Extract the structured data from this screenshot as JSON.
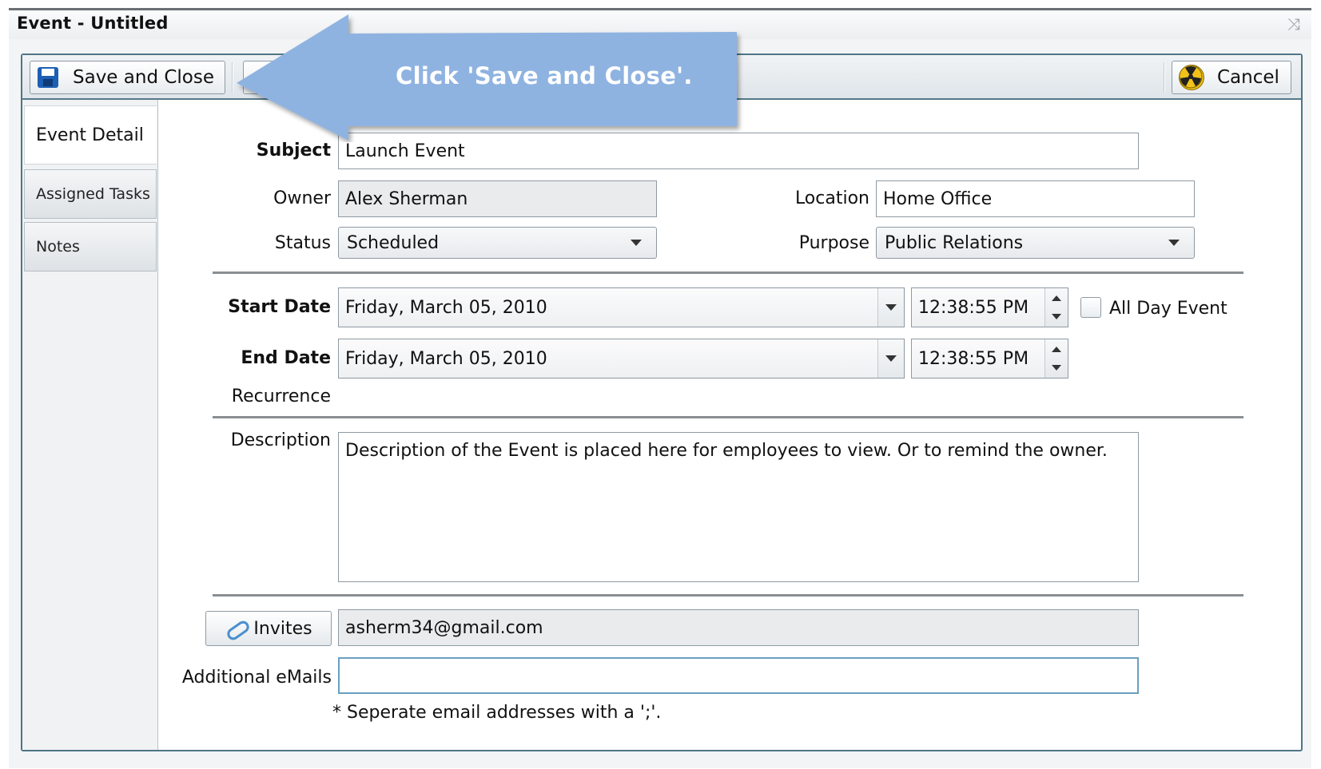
{
  "window": {
    "title": "Event - Untitled",
    "close_glyph": "⤨"
  },
  "toolbar": {
    "save_label": "Save and Close",
    "cancel_label": "Cancel"
  },
  "callout": {
    "text": "Click 'Save and Close'."
  },
  "tabs": [
    {
      "label": "Event Detail"
    },
    {
      "label": "Assigned Tasks"
    },
    {
      "label": "Notes"
    }
  ],
  "form": {
    "subject": {
      "label": "Subject",
      "value": "Launch Event"
    },
    "owner": {
      "label": "Owner",
      "value": "Alex Sherman"
    },
    "location": {
      "label": "Location",
      "value": "Home Office"
    },
    "status": {
      "label": "Status",
      "value": "Scheduled"
    },
    "purpose": {
      "label": "Purpose",
      "value": "Public Relations"
    },
    "start": {
      "label": "Start Date",
      "date": "Friday, March 05, 2010",
      "time": "12:38:55 PM"
    },
    "all_day": {
      "label": "All Day Event",
      "checked": false
    },
    "end": {
      "label": "End Date",
      "date": "Friday, March 05, 2010",
      "time": "12:38:55 PM"
    },
    "recurrence": {
      "label": "Recurrence"
    },
    "description": {
      "label": "Description",
      "value": "Description of the Event is placed here for employees to view. Or to remind the owner."
    },
    "invites": {
      "button_label": "Invites",
      "value": "asherm34@gmail.com"
    },
    "additional_emails": {
      "label": "Additional eMails",
      "value": ""
    },
    "hint": "* Seperate email addresses with a ';'."
  },
  "colors": {
    "frame": "#4f7586",
    "callout": "#8fb3e1",
    "save_icon": "#1c5fb4"
  }
}
